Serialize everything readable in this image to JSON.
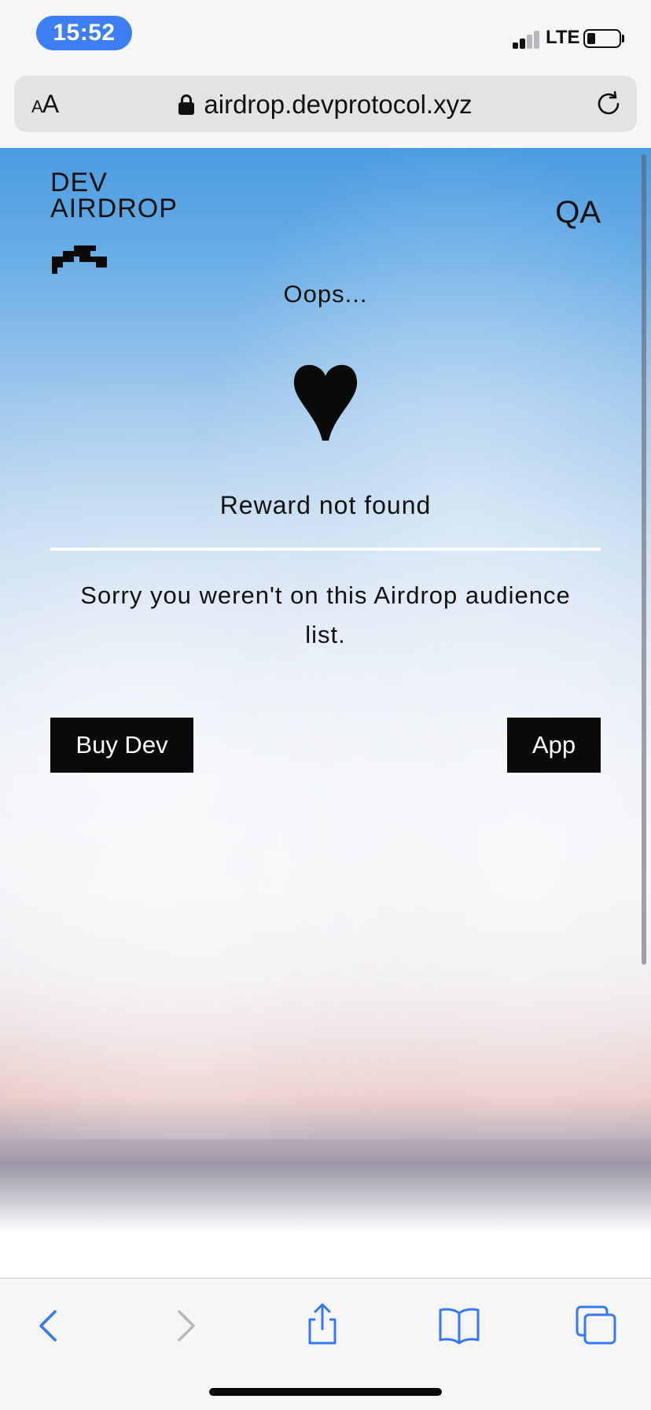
{
  "status_bar": {
    "time": "15:52",
    "network": "LTE",
    "accent_color": "#3d7ff2"
  },
  "browser": {
    "text_size_label": "AA",
    "url": "airdrop.devprotocol.xyz",
    "lock_icon": "lock-icon",
    "reload_icon": "reload-icon"
  },
  "site": {
    "logo_line1": "DEV",
    "logo_line2": "AIRDROP",
    "nav_qa": "QA"
  },
  "result": {
    "heading": "Oops...",
    "icon": "heart-icon",
    "title": "Reward not found",
    "message": "Sorry you weren't on this Airdrop audience list."
  },
  "actions": {
    "buy_label": "Buy Dev",
    "app_label": "App"
  },
  "toolbar": {
    "icons": [
      "back-icon",
      "forward-icon",
      "share-icon",
      "bookmarks-icon",
      "tabs-icon"
    ],
    "icon_color": "#3478f6"
  }
}
